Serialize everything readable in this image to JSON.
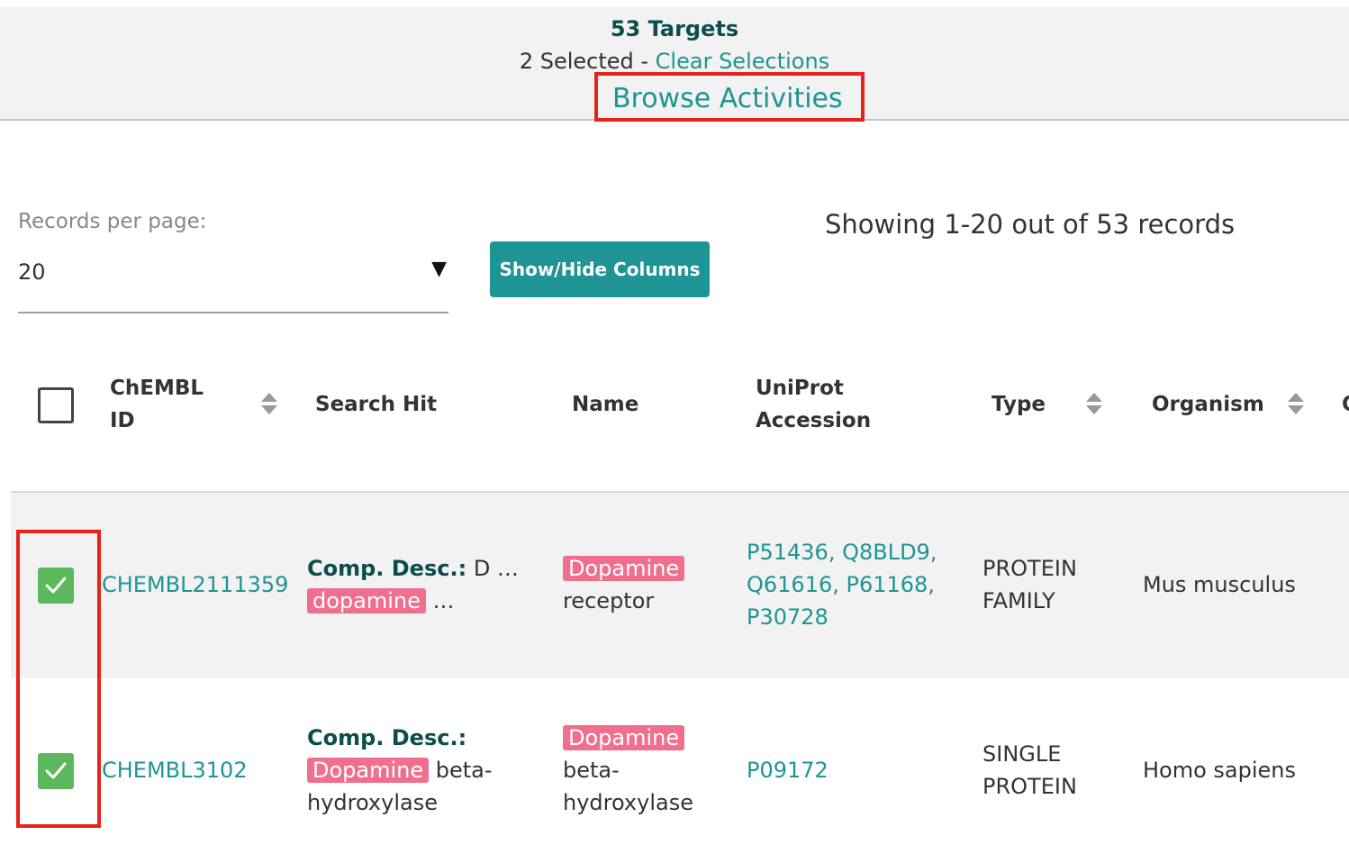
{
  "summary": {
    "targets_count": "53 Targets",
    "selected": "2 Selected",
    "separator": " - ",
    "clear_selections": "Clear Selections",
    "browse_activities": "Browse Activities"
  },
  "controls": {
    "records_per_page_label": "Records per page:",
    "records_per_page_value": "20",
    "dropdown_arrow": "▼",
    "show_hide_columns": "Show/Hide Columns",
    "showing_text": "Showing 1-20 out of 53 records"
  },
  "table": {
    "headers": {
      "chembl_id_line1": "ChEMBL",
      "chembl_id_line2": "ID",
      "search_hit": "Search Hit",
      "name": "Name",
      "uniprot_line1": "UniProt",
      "uniprot_line2": "Accession",
      "type": "Type",
      "organism": "Organism",
      "next_partial": "C"
    },
    "rows": [
      {
        "checked": true,
        "chembl_id": "CHEMBL2111359",
        "search_hit_label": "Comp. Desc.:",
        "search_hit_text1": " D …",
        "search_hit_highlight": "dopamine",
        "search_hit_text2": " …",
        "name_highlight": "Dopamine",
        "name_rest": "receptor",
        "uniprot_line1": "P51436, Q8BLD9,",
        "uniprot_line2": "Q61616, P61168,",
        "uniprot_line3": "P30728",
        "type_line1": "PROTEIN",
        "type_line2": "FAMILY",
        "organism": "Mus musculus"
      },
      {
        "checked": true,
        "chembl_id": "CHEMBL3102",
        "search_hit_label": "Comp. Desc.:",
        "search_hit_highlight": "Dopamine",
        "search_hit_text1": " beta-",
        "search_hit_text2": "hydroxylase",
        "name_highlight": "Dopamine",
        "name_line2": "beta-",
        "name_line3": "hydroxylase",
        "uniprot": "P09172",
        "type_line1": "SINGLE",
        "type_line2": "PROTEIN",
        "organism": "Homo sapiens"
      }
    ]
  },
  "colors": {
    "teal": "#1f9494",
    "dark_teal": "#0d4d4d",
    "highlight": "#f06f8e",
    "check_green": "#5cb85c",
    "annotation_red": "#e5231b"
  }
}
